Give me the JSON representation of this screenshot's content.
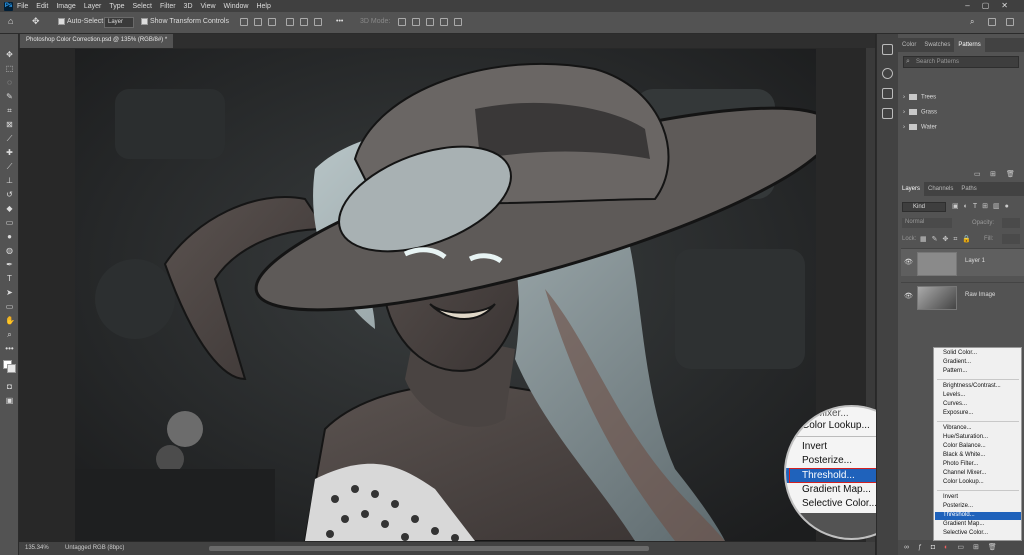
{
  "menubar": {
    "items": [
      "File",
      "Edit",
      "Image",
      "Layer",
      "Type",
      "Select",
      "Filter",
      "3D",
      "View",
      "Window",
      "Help"
    ]
  },
  "options": {
    "auto_select": "Auto-Select",
    "layer_dropdown": "Layer",
    "show_transform": "Show Transform Controls",
    "mode_3d": "3D Mode:"
  },
  "document": {
    "tab_title": "Photoshop Color Correction.psd @ 135% (RGB/8#) *",
    "zoom": "135.34%",
    "profile": "Untagged RGB (8bpc)"
  },
  "patterns_panel": {
    "tabs": [
      "Color",
      "Swatches",
      "Patterns"
    ],
    "active_tab": "Patterns",
    "search_placeholder": "Search Patterns",
    "folders": [
      "Trees",
      "Grass",
      "Water"
    ]
  },
  "layers_panel": {
    "tabs": [
      "Layers",
      "Channels",
      "Paths"
    ],
    "filter_kind": "Kind",
    "blend_mode": "Normal",
    "opacity_label": "Opacity:",
    "lock_label": "Lock:",
    "fill_label": "Fill:",
    "layers": [
      {
        "name": "Layer 1"
      },
      {
        "name": "Raw Image"
      }
    ]
  },
  "adjustment_menu": {
    "items": [
      "Solid Color...",
      "Gradient...",
      "Pattern...",
      "Brightness/Contrast...",
      "Levels...",
      "Curves...",
      "Exposure...",
      "Vibrance...",
      "Hue/Saturation...",
      "Color Balance...",
      "Black & White...",
      "Photo Filter...",
      "Channel Mixer...",
      "Color Lookup...",
      "Invert",
      "Posterize...",
      "Threshold...",
      "Gradient Map...",
      "Selective Color..."
    ],
    "highlighted": "Threshold..."
  },
  "zoom_callout": {
    "items": [
      "Color Lookup...",
      "Invert",
      "Posterize...",
      "Threshold...",
      "Gradient Map...",
      "Selective Color..."
    ],
    "partial_top": "...r Mixer...",
    "highlighted": "Threshold..."
  },
  "colors": {
    "highlight": "#1f62bb",
    "callout_border": "#d32020",
    "panel_bg": "#535353"
  }
}
